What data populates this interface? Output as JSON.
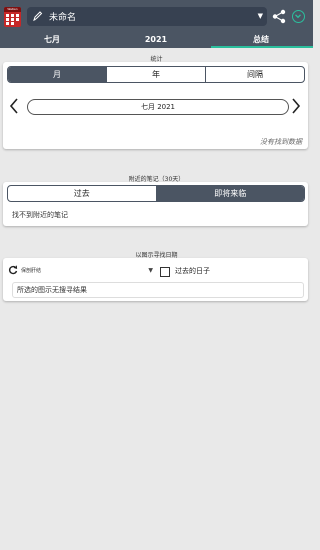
{
  "header": {
    "app_icon_text": "WeKan",
    "title": "未命名",
    "icons": [
      "app-calendar-icon",
      "pen-icon",
      "share-icon",
      "chevron-down-icon"
    ],
    "accent_color": "#2bbf9d"
  },
  "tabs": [
    {
      "label": "七月"
    },
    {
      "label": "2021"
    },
    {
      "label": "总结",
      "active": true
    }
  ],
  "stats": {
    "section_label": "统计",
    "segments": [
      "月",
      "年",
      "间隔"
    ],
    "selected_segment": "月",
    "period_label": "七月 2021",
    "no_data_text": "没有找到数据"
  },
  "notes": {
    "section_label": "附近的笔记（30天）",
    "segments": [
      "过去",
      "即将来临"
    ],
    "selected_segment": "即将来临",
    "empty_text": "找不到附近的笔记"
  },
  "find_by_icon": {
    "section_label": "以图示寻找日期",
    "selected_icon_label": "保剖肝结",
    "checkbox_label": "过去的日子",
    "checkbox_checked": false,
    "result_text": "所选的图示无搜寻结果"
  }
}
